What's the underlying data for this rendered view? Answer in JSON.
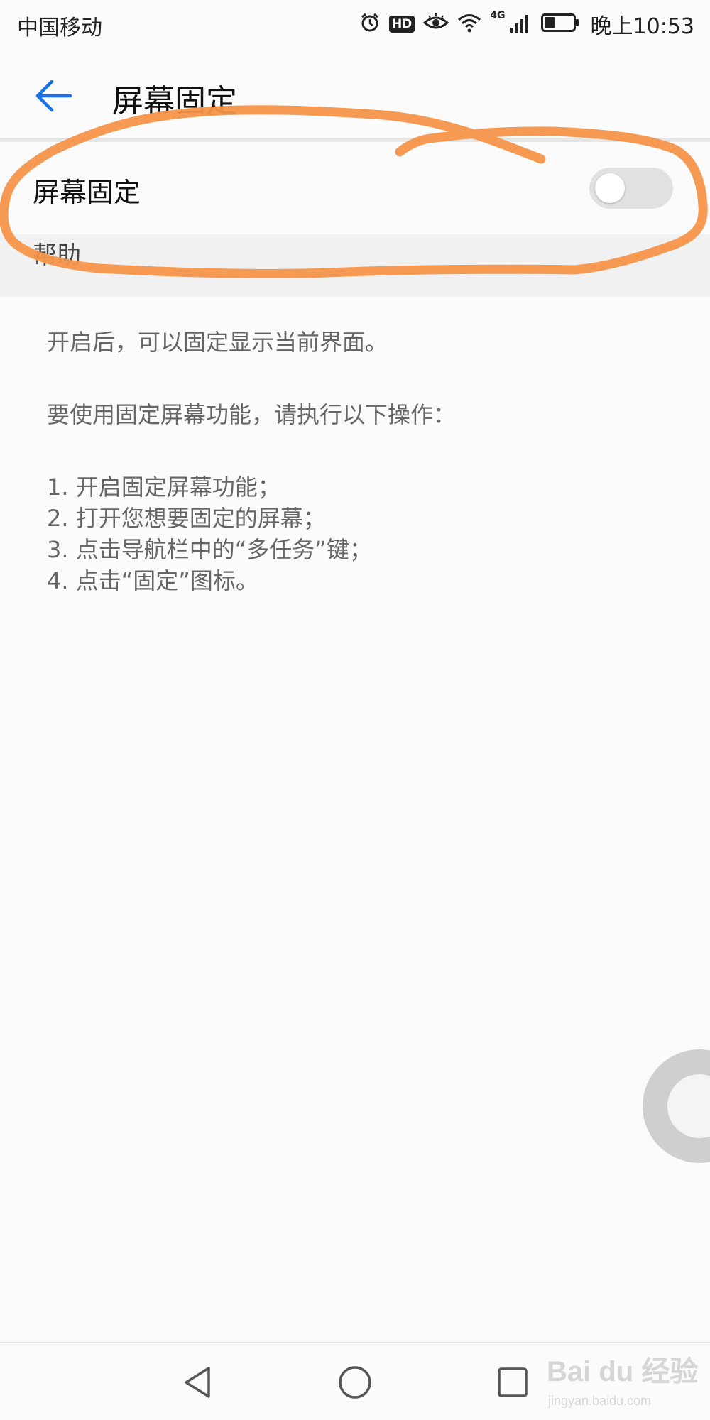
{
  "status_bar": {
    "carrier": "中国移动",
    "network": "4G",
    "time": "晚上10:53",
    "hd_label": "HD",
    "icons": [
      "alarm-icon",
      "hd-icon",
      "eye-comfort-icon",
      "wifi-icon",
      "signal-icon",
      "battery-icon"
    ],
    "battery_level": 0.35
  },
  "app_bar": {
    "back_icon": "arrow-left-icon",
    "title": "屏幕固定"
  },
  "setting": {
    "label": "屏幕固定",
    "toggle_on": false
  },
  "help": {
    "title": "帮助",
    "paragraphs": [
      "开启后，可以固定显示当前界面。",
      "要使用固定屏幕功能，请执行以下操作："
    ],
    "steps": [
      "1. 开启固定屏幕功能；",
      "2. 打开您想要固定的屏幕；",
      "3. 点击导航栏中的“多任务”键；",
      "4. 点击“固定”图标。"
    ]
  },
  "nav_bar": {
    "buttons": [
      "back-triangle-icon",
      "home-circle-icon",
      "recents-square-icon"
    ]
  },
  "watermark": {
    "logo": "Bai du 经验",
    "url": "jingyan.baidu.com"
  },
  "colors": {
    "accent": "#1a73e8",
    "annotation": "#f4944a",
    "toggle_off": "#e2e2e2"
  }
}
